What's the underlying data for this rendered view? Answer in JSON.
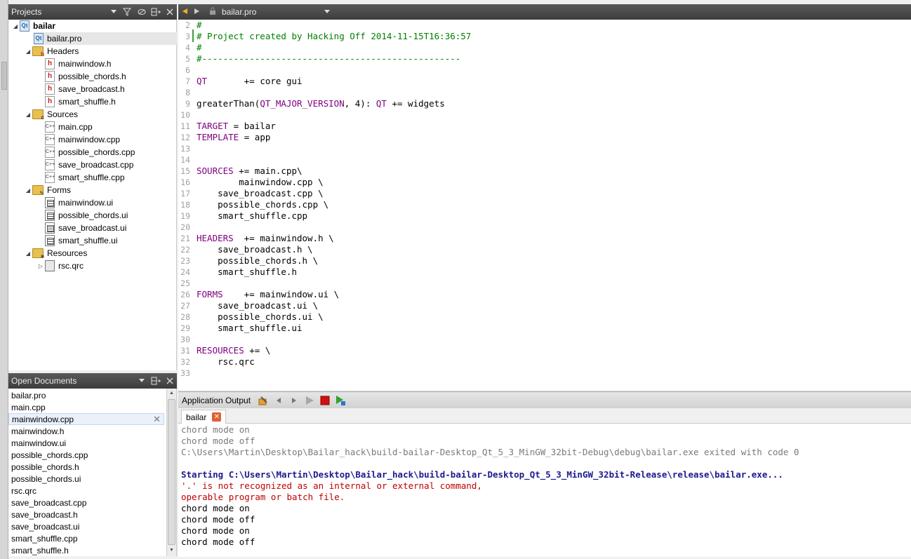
{
  "projects_panel": {
    "title": "Projects",
    "tree": [
      {
        "label": "bailar",
        "kind": "project-root",
        "depth": 0,
        "expanded": true
      },
      {
        "label": "bailar.pro",
        "kind": "pro",
        "depth": 1
      },
      {
        "label": "Headers",
        "kind": "folder-h",
        "depth": 1,
        "expanded": true
      },
      {
        "label": "mainwindow.h",
        "kind": "h",
        "depth": 2
      },
      {
        "label": "possible_chords.h",
        "kind": "h",
        "depth": 2
      },
      {
        "label": "save_broadcast.h",
        "kind": "h",
        "depth": 2
      },
      {
        "label": "smart_shuffle.h",
        "kind": "h",
        "depth": 2
      },
      {
        "label": "Sources",
        "kind": "folder-cpp",
        "depth": 1,
        "expanded": true
      },
      {
        "label": "main.cpp",
        "kind": "cpp",
        "depth": 2
      },
      {
        "label": "mainwindow.cpp",
        "kind": "cpp",
        "depth": 2
      },
      {
        "label": "possible_chords.cpp",
        "kind": "cpp",
        "depth": 2
      },
      {
        "label": "save_broadcast.cpp",
        "kind": "cpp",
        "depth": 2
      },
      {
        "label": "smart_shuffle.cpp",
        "kind": "cpp",
        "depth": 2
      },
      {
        "label": "Forms",
        "kind": "folder-ui",
        "depth": 1,
        "expanded": true
      },
      {
        "label": "mainwindow.ui",
        "kind": "ui",
        "depth": 2
      },
      {
        "label": "possible_chords.ui",
        "kind": "ui",
        "depth": 2
      },
      {
        "label": "save_broadcast.ui",
        "kind": "ui",
        "depth": 2
      },
      {
        "label": "smart_shuffle.ui",
        "kind": "ui",
        "depth": 2
      },
      {
        "label": "Resources",
        "kind": "folder-res",
        "depth": 1,
        "expanded": true
      },
      {
        "label": "rsc.qrc",
        "kind": "qrc",
        "depth": 2,
        "collapsed": true
      }
    ]
  },
  "open_documents": {
    "title": "Open Documents",
    "items": [
      "bailar.pro",
      "main.cpp",
      "mainwindow.cpp",
      "mainwindow.h",
      "mainwindow.ui",
      "possible_chords.cpp",
      "possible_chords.h",
      "possible_chords.ui",
      "rsc.qrc",
      "save_broadcast.cpp",
      "save_broadcast.h",
      "save_broadcast.ui",
      "smart_shuffle.cpp",
      "smart_shuffle.h"
    ],
    "selected": "mainwindow.cpp",
    "close_glyph": "✕"
  },
  "editor": {
    "file_name": "bailar.pro",
    "lines": [
      {
        "n": "2",
        "segments": [
          {
            "t": "#",
            "c": "green"
          }
        ]
      },
      {
        "n": "3",
        "segments": [
          {
            "t": "# Project created by Hacking Off 2014-11-15T16:36:57",
            "c": "green"
          }
        ]
      },
      {
        "n": "4",
        "segments": [
          {
            "t": "#",
            "c": "green"
          }
        ]
      },
      {
        "n": "5",
        "segments": [
          {
            "t": "#-------------------------------------------------",
            "c": "green"
          }
        ]
      },
      {
        "n": "6",
        "segments": []
      },
      {
        "n": "7",
        "segments": [
          {
            "t": "QT",
            "c": "purple"
          },
          {
            "t": "       += core gui",
            "c": "black"
          }
        ]
      },
      {
        "n": "8",
        "segments": []
      },
      {
        "n": "9",
        "segments": [
          {
            "t": "greaterThan(",
            "c": "black"
          },
          {
            "t": "QT_MAJOR_VERSION",
            "c": "purple"
          },
          {
            "t": ", 4): ",
            "c": "black"
          },
          {
            "t": "QT",
            "c": "purple"
          },
          {
            "t": " += widgets",
            "c": "black"
          }
        ]
      },
      {
        "n": "10",
        "segments": []
      },
      {
        "n": "11",
        "segments": [
          {
            "t": "TARGET",
            "c": "purple"
          },
          {
            "t": " = bailar",
            "c": "black"
          }
        ]
      },
      {
        "n": "12",
        "segments": [
          {
            "t": "TEMPLATE",
            "c": "purple"
          },
          {
            "t": " = app",
            "c": "black"
          }
        ]
      },
      {
        "n": "13",
        "segments": []
      },
      {
        "n": "14",
        "segments": []
      },
      {
        "n": "15",
        "segments": [
          {
            "t": "SOURCES",
            "c": "purple"
          },
          {
            "t": " += main.cpp\\",
            "c": "black"
          }
        ]
      },
      {
        "n": "16",
        "segments": [
          {
            "t": "        mainwindow.cpp \\",
            "c": "black"
          }
        ]
      },
      {
        "n": "17",
        "segments": [
          {
            "t": "    save_broadcast.cpp \\",
            "c": "black"
          }
        ]
      },
      {
        "n": "18",
        "segments": [
          {
            "t": "    possible_chords.cpp \\",
            "c": "black"
          }
        ]
      },
      {
        "n": "19",
        "segments": [
          {
            "t": "    smart_shuffle.cpp",
            "c": "black"
          }
        ]
      },
      {
        "n": "20",
        "segments": []
      },
      {
        "n": "21",
        "segments": [
          {
            "t": "HEADERS",
            "c": "purple"
          },
          {
            "t": "  += mainwindow.h \\",
            "c": "black"
          }
        ]
      },
      {
        "n": "22",
        "segments": [
          {
            "t": "    save_broadcast.h \\",
            "c": "black"
          }
        ]
      },
      {
        "n": "23",
        "segments": [
          {
            "t": "    possible_chords.h \\",
            "c": "black"
          }
        ]
      },
      {
        "n": "24",
        "segments": [
          {
            "t": "    smart_shuffle.h",
            "c": "black"
          }
        ]
      },
      {
        "n": "25",
        "segments": []
      },
      {
        "n": "26",
        "segments": [
          {
            "t": "FORMS",
            "c": "purple"
          },
          {
            "t": "    += mainwindow.ui \\",
            "c": "black"
          }
        ]
      },
      {
        "n": "27",
        "segments": [
          {
            "t": "    save_broadcast.ui \\",
            "c": "black"
          }
        ]
      },
      {
        "n": "28",
        "segments": [
          {
            "t": "    possible_chords.ui \\",
            "c": "black"
          }
        ]
      },
      {
        "n": "29",
        "segments": [
          {
            "t": "    smart_shuffle.ui",
            "c": "black"
          }
        ]
      },
      {
        "n": "30",
        "segments": []
      },
      {
        "n": "31",
        "segments": [
          {
            "t": "RESOURCES",
            "c": "purple"
          },
          {
            "t": " += \\",
            "c": "black"
          }
        ]
      },
      {
        "n": "32",
        "segments": [
          {
            "t": "    rsc.qrc",
            "c": "black"
          }
        ]
      },
      {
        "n": "33",
        "segments": []
      }
    ]
  },
  "output_panel": {
    "title": "Application Output",
    "tab_label": "bailar",
    "tab_close": "✕",
    "lines": [
      {
        "t": "chord mode on",
        "c": "gray"
      },
      {
        "t": "chord mode off",
        "c": "gray"
      },
      {
        "t": "C:\\Users\\Martin\\Desktop\\Bailar_hack\\build-bailar-Desktop_Qt_5_3_MinGW_32bit-Debug\\debug\\bailar.exe exited with code 0",
        "c": "gray"
      },
      {
        "t": "",
        "c": "black"
      },
      {
        "t": "Starting C:\\Users\\Martin\\Desktop\\Bailar_hack\\build-bailar-Desktop_Qt_5_3_MinGW_32bit-Release\\release\\bailar.exe...",
        "c": "blue"
      },
      {
        "t": "'.' is not recognized as an internal or external command,",
        "c": "red"
      },
      {
        "t": "operable program or batch file.",
        "c": "red"
      },
      {
        "t": "chord mode on",
        "c": "black"
      },
      {
        "t": "chord mode off",
        "c": "black"
      },
      {
        "t": "chord mode on",
        "c": "black"
      },
      {
        "t": "chord mode off",
        "c": "black"
      }
    ]
  },
  "colors": {
    "header_dark": "#3c3c3c",
    "keyword": "#800080",
    "comment": "#008000",
    "error": "#c00000",
    "info": "#1a1a8f"
  }
}
